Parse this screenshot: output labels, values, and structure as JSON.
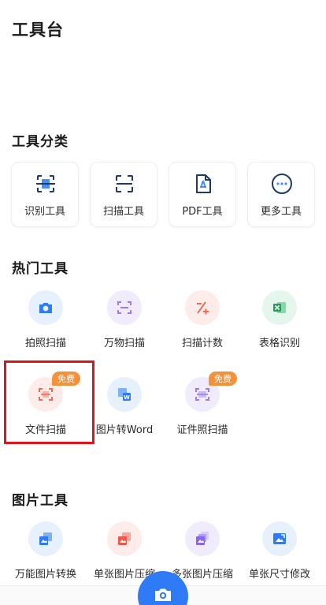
{
  "header": {
    "title": "工具台"
  },
  "categories": {
    "title": "工具分类",
    "items": [
      {
        "label": "识别工具",
        "icon": "scan-recognize-icon"
      },
      {
        "label": "扫描工具",
        "icon": "scan-frame-icon"
      },
      {
        "label": "PDF工具",
        "icon": "pdf-file-icon"
      },
      {
        "label": "更多工具",
        "icon": "more-dots-icon"
      }
    ]
  },
  "hot_tools": {
    "title": "热门工具",
    "items": [
      {
        "label": "拍照扫描",
        "icon": "camera-icon",
        "badge": ""
      },
      {
        "label": "万物扫描",
        "icon": "scan-object-icon",
        "badge": ""
      },
      {
        "label": "扫描计数",
        "icon": "count-icon",
        "badge": ""
      },
      {
        "label": "表格识别",
        "icon": "excel-icon",
        "badge": ""
      },
      {
        "label": "文件扫描",
        "icon": "document-scan-icon",
        "badge": "免费"
      },
      {
        "label": "图片转Word",
        "icon": "image-to-word-icon",
        "badge": ""
      },
      {
        "label": "证件照扫描",
        "icon": "id-card-scan-icon",
        "badge": "免费"
      }
    ]
  },
  "image_tools": {
    "title": "图片工具",
    "items": [
      {
        "label": "万能图片转换",
        "icon": "image-convert-icon"
      },
      {
        "label": "单张图片压缩",
        "icon": "image-compress-icon"
      },
      {
        "label": "多张图片压缩",
        "icon": "multi-image-compress-icon"
      },
      {
        "label": "单张尺寸修改",
        "icon": "image-resize-icon"
      }
    ]
  },
  "colors": {
    "accent_blue": "#2f7bf6",
    "badge_orange": "#f3923a",
    "highlight_red": "#e1141a"
  }
}
